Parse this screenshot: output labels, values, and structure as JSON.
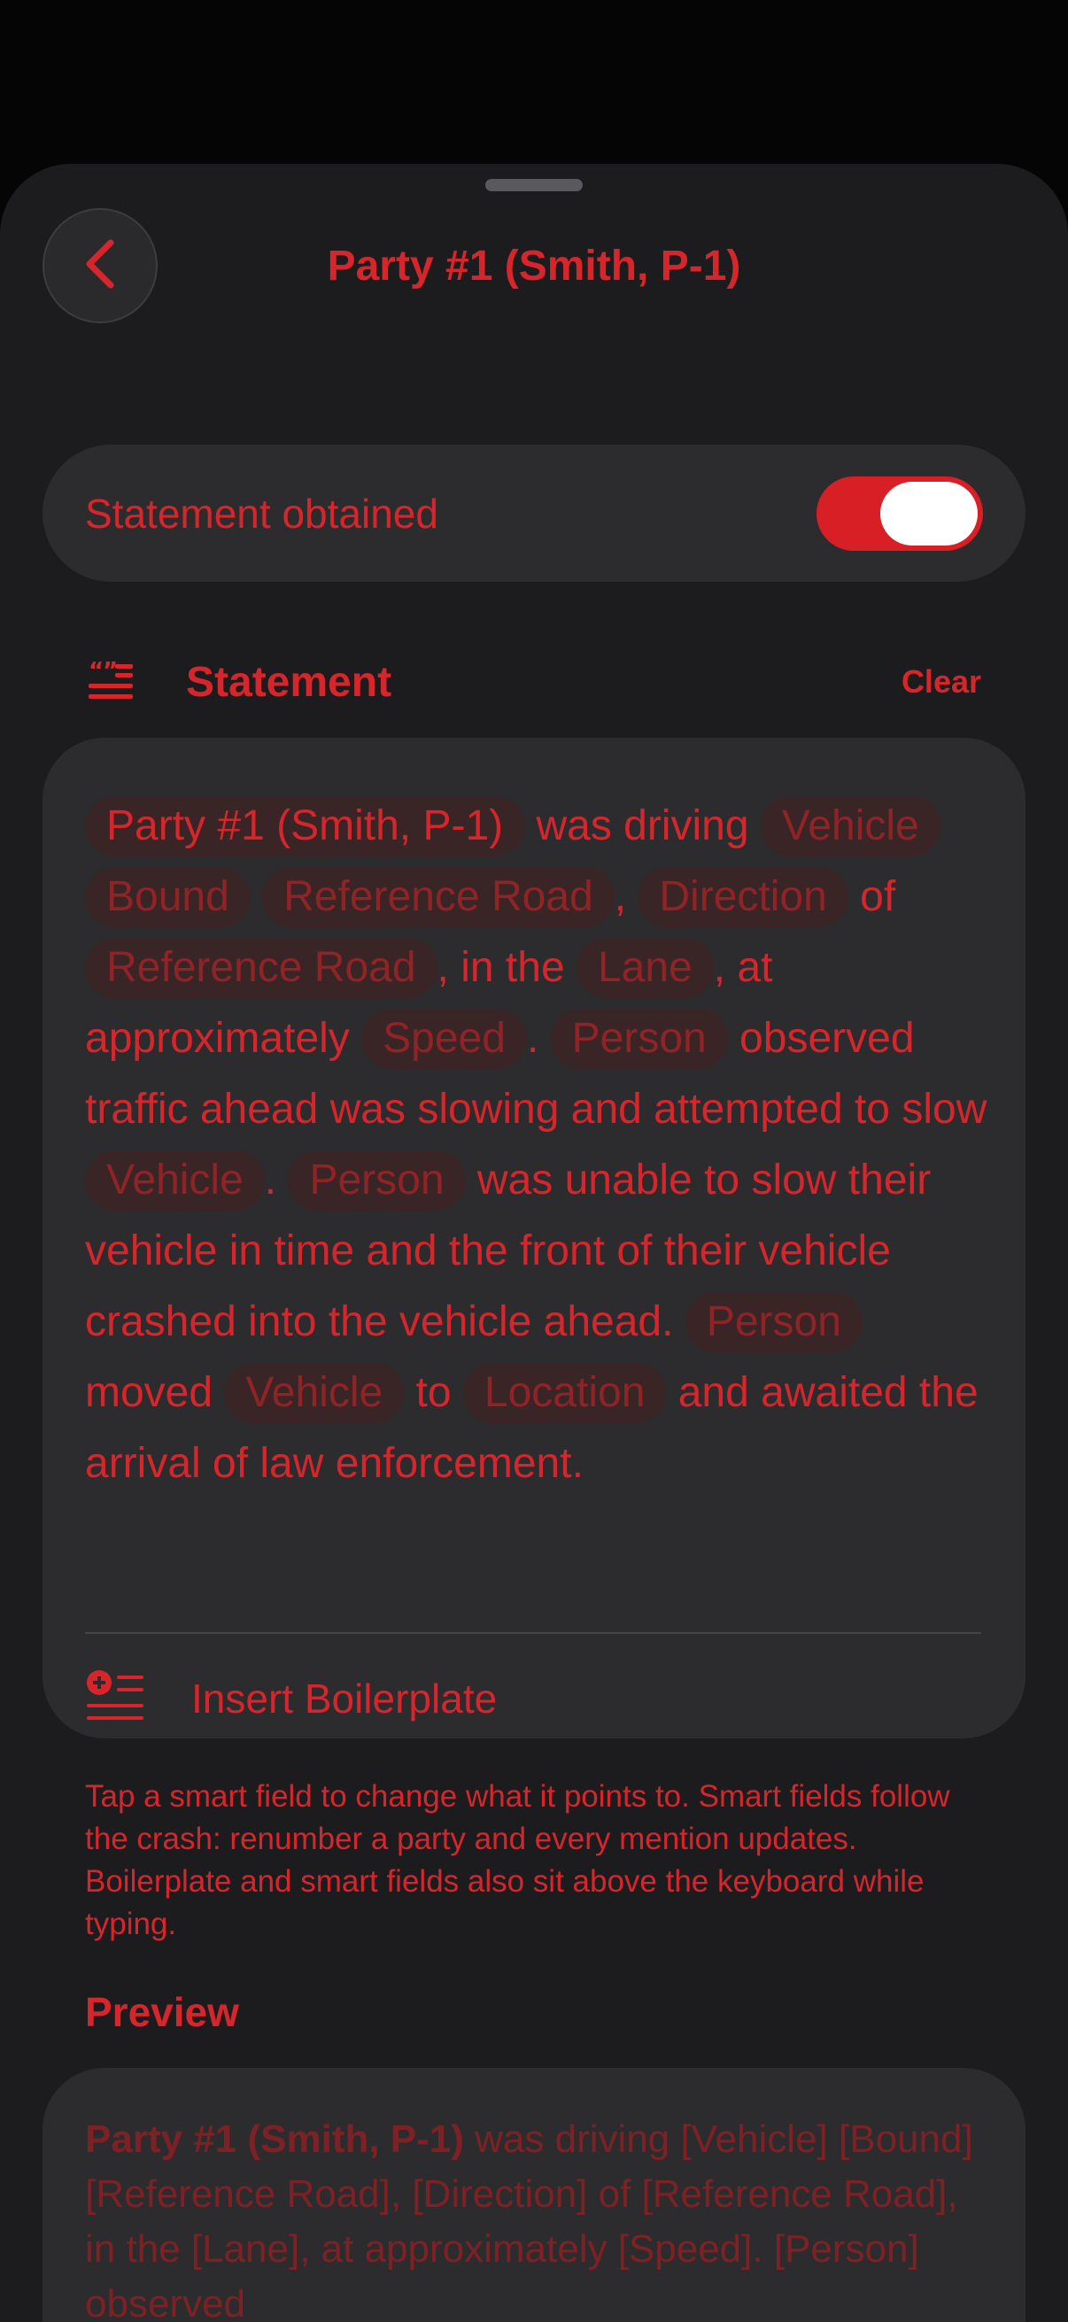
{
  "header": {
    "title": "Party #1 (Smith, P-1)"
  },
  "toggle_row": {
    "label": "Statement obtained",
    "on": true
  },
  "statement_section": {
    "title": "Statement",
    "clear_label": "Clear",
    "party_chip": "Party #1 (Smith, P-1)",
    "t1": " was driving ",
    "chip_vehicle_1": "Vehicle",
    "chip_bound": "Bound",
    "chip_ref_road_1": "Reference Road",
    "t2": ",",
    "chip_direction": "Direction",
    "t3": " of ",
    "chip_ref_road_2": "Reference Road",
    "t4": ", in the",
    "chip_lane": "Lane",
    "t5": ", at approximately ",
    "chip_speed": "Speed",
    "t6": ".",
    "chip_person_1": "Person",
    "t7": " observed traffic ahead was slowing and attempted to slow ",
    "chip_vehicle_2": "Vehicle",
    "t8": ".",
    "chip_person_2": "Person",
    "t9": " was unable to slow their vehicle in time and the front of their vehicle crashed into the vehicle ahead. ",
    "chip_person_3": "Person",
    "t10": " moved",
    "chip_vehicle_3": "Vehicle",
    "t11": " to ",
    "chip_location": "Location",
    "t12": " and awaited the arrival of law enforcement.",
    "insert_label": "Insert Boilerplate"
  },
  "help_text": "Tap a smart field to change what it points to. Smart fields follow the crash: renumber a party and every mention updates. Boilerplate and smart fields also sit above the keyboard while typing.",
  "preview": {
    "title": "Preview",
    "party": "Party #1 (Smith, P-1)",
    "text": " was driving [Vehicle] [Bound] [Reference Road], [Direction] of [Reference Road], in the [Lane], at approximately [Speed]. [Person] observed"
  },
  "colors": {
    "accent": "#d6262b",
    "background": "#1c1c1e",
    "card": "#2c2c2e"
  },
  "icons": [
    "chevron-left-icon",
    "quote-lines-icon",
    "add-list-icon"
  ]
}
